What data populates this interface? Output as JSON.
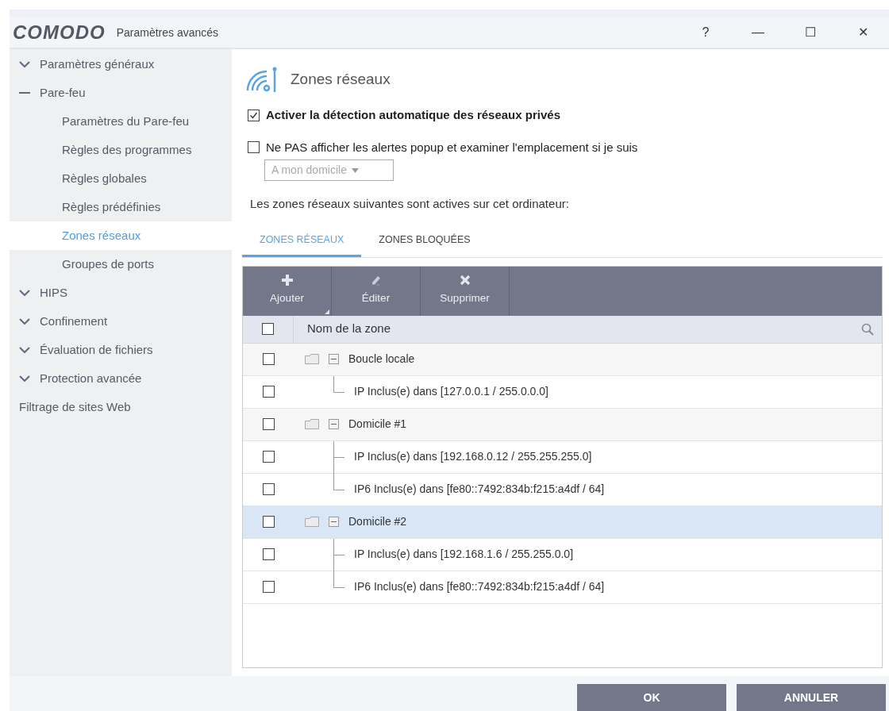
{
  "window": {
    "brand": "COMODO",
    "title": "Paramètres avancés",
    "controls": [
      "?",
      "—",
      "☐",
      "✕"
    ]
  },
  "sidebar": {
    "items": [
      {
        "label": "Paramètres généraux",
        "expanded": false
      },
      {
        "label": "Pare-feu",
        "expanded": true,
        "children": [
          {
            "label": "Paramètres du Pare-feu",
            "selected": false
          },
          {
            "label": "Règles des programmes",
            "selected": false
          },
          {
            "label": "Règles globales",
            "selected": false
          },
          {
            "label": "Règles prédéfinies",
            "selected": false
          },
          {
            "label": "Zones réseaux",
            "selected": true
          },
          {
            "label": "Groupes de ports",
            "selected": false
          }
        ]
      },
      {
        "label": "HIPS",
        "expanded": false
      },
      {
        "label": "Confinement",
        "expanded": false
      },
      {
        "label": "Évaluation de fichiers",
        "expanded": false
      },
      {
        "label": "Protection avancée",
        "expanded": false
      },
      {
        "label": "Filtrage de sites Web"
      }
    ]
  },
  "content": {
    "heading": "Zones réseaux",
    "options": [
      {
        "label": "Activer la détection automatique des réseaux privés",
        "checked": true
      },
      {
        "label": "Ne PAS afficher les alertes popup et examiner l'emplacement si je suis",
        "checked": false
      }
    ],
    "location_select": {
      "value": "A mon domicile",
      "disabled": true
    },
    "intro": "Les zones réseaux suivantes sont actives sur cet ordinateur:",
    "tabs": [
      {
        "label": "ZONES RÉSEAUX",
        "selected": true
      },
      {
        "label": "ZONES BLOQUÉES",
        "selected": false
      }
    ],
    "toolbar": [
      {
        "kind": "add",
        "label": "Ajouter"
      },
      {
        "kind": "edit",
        "label": "Éditer"
      },
      {
        "kind": "delete",
        "label": "Supprimer"
      }
    ],
    "table": {
      "columns": [
        "Nom de la zone"
      ],
      "header_checked": false,
      "rows": [
        {
          "name": "Boucle locale",
          "checked": false,
          "selected": false,
          "children": [
            {
              "name": "IP Inclus(e) dans [127.0.0.1 / 255.0.0.0]",
              "checked": false,
              "selected": false
            }
          ]
        },
        {
          "name": "Domicile #1",
          "checked": false,
          "selected": false,
          "children": [
            {
              "name": "IP Inclus(e) dans [192.168.0.12 / 255.255.255.0]",
              "checked": false,
              "selected": false
            },
            {
              "name": "IP6 Inclus(e) dans [fe80::7492:834b:f215:a4df / 64]",
              "checked": false,
              "selected": false
            }
          ]
        },
        {
          "name": "Domicile #2",
          "checked": false,
          "selected": true,
          "children": [
            {
              "name": "IP Inclus(e) dans [192.168.1.6 / 255.255.0.0]",
              "checked": false,
              "selected": false
            },
            {
              "name": "IP6 Inclus(e) dans [fe80::7492:834b:f215:a4df / 64]",
              "checked": false,
              "selected": false
            }
          ]
        }
      ]
    }
  },
  "buttons": [
    "OK",
    "ANNULER"
  ]
}
